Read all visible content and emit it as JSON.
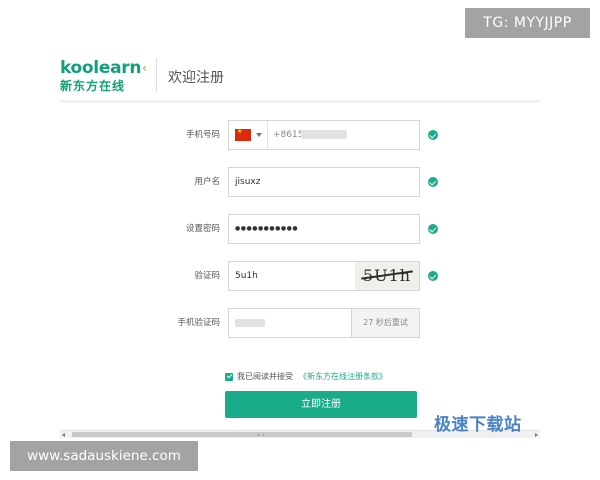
{
  "watermarks": {
    "top_right": "TG: MYYJJPP",
    "bottom_left": "www.sadauskiene.com",
    "bottom_right": "极速下载站"
  },
  "header": {
    "logo_en": "koolearn",
    "logo_cn": "新东方在线",
    "title": "欢迎注册"
  },
  "form": {
    "phone": {
      "label": "手机号码",
      "value": "+8615"
    },
    "username": {
      "label": "用户名",
      "value": "jisuxz"
    },
    "password": {
      "label": "设置密码",
      "value": "●●●●●●●●●●●"
    },
    "captcha": {
      "label": "验证码",
      "value": "5u1h",
      "image_text": "5U1h"
    },
    "sms": {
      "label": "手机验证码",
      "value": "",
      "button": "27 秒后重试"
    }
  },
  "agreement": {
    "text": "我已阅读并接受",
    "link": "《新东方在线注册条款》",
    "checked": true
  },
  "submit_label": "立即注册",
  "colors": {
    "accent": "#1aab8a",
    "brand": "#12a07a",
    "watermark_gray": "#a3a3a3",
    "watermark_blue": "#4a82c8"
  }
}
